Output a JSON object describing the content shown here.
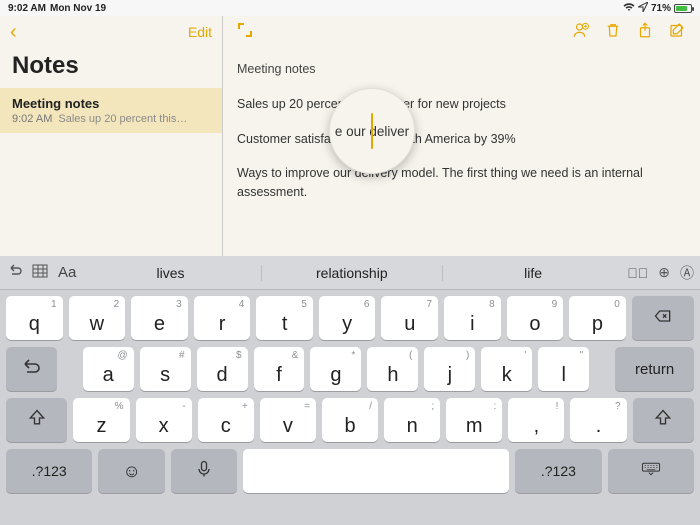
{
  "status": {
    "time": "9:02 AM",
    "date": "Mon Nov 19",
    "battery_pct": "71%",
    "battery_fill": 71
  },
  "sidebar": {
    "edit_label": "Edit",
    "title": "Notes",
    "item": {
      "title": "Meeting notes",
      "time": "9:02 AM",
      "preview": "Sales up 20 percent this…"
    }
  },
  "note": {
    "title": "Meeting notes",
    "p1": "Sales up 20 percent this quarter for new projects",
    "p2": "Customer satisfaction up in North America by 39%",
    "p3": "Ways to improve our delivery model. The first thing we need is an internal assessment."
  },
  "lens": {
    "text": "e our deliver"
  },
  "keyboard": {
    "suggestions": [
      "lives",
      "relationship",
      "life"
    ],
    "row1": [
      {
        "m": "q",
        "h": "1"
      },
      {
        "m": "w",
        "h": "2"
      },
      {
        "m": "e",
        "h": "3"
      },
      {
        "m": "r",
        "h": "4"
      },
      {
        "m": "t",
        "h": "5"
      },
      {
        "m": "y",
        "h": "6"
      },
      {
        "m": "u",
        "h": "7"
      },
      {
        "m": "i",
        "h": "8"
      },
      {
        "m": "o",
        "h": "9"
      },
      {
        "m": "p",
        "h": "0"
      }
    ],
    "row2": [
      {
        "m": "a",
        "h": "@"
      },
      {
        "m": "s",
        "h": "#"
      },
      {
        "m": "d",
        "h": "$"
      },
      {
        "m": "f",
        "h": "&"
      },
      {
        "m": "g",
        "h": "*"
      },
      {
        "m": "h",
        "h": "("
      },
      {
        "m": "j",
        "h": ")"
      },
      {
        "m": "k",
        "h": "'"
      },
      {
        "m": "l",
        "h": "\""
      }
    ],
    "row3": [
      {
        "m": "z",
        "h": "%"
      },
      {
        "m": "x",
        "h": "-"
      },
      {
        "m": "c",
        "h": "+"
      },
      {
        "m": "v",
        "h": "="
      },
      {
        "m": "b",
        "h": "/"
      },
      {
        "m": "n",
        "h": ";"
      },
      {
        "m": "m",
        "h": ":"
      },
      {
        "m": ",",
        "h": "!"
      },
      {
        "m": ".",
        "h": "?"
      }
    ],
    "return": "return",
    "mode": ".?123"
  }
}
